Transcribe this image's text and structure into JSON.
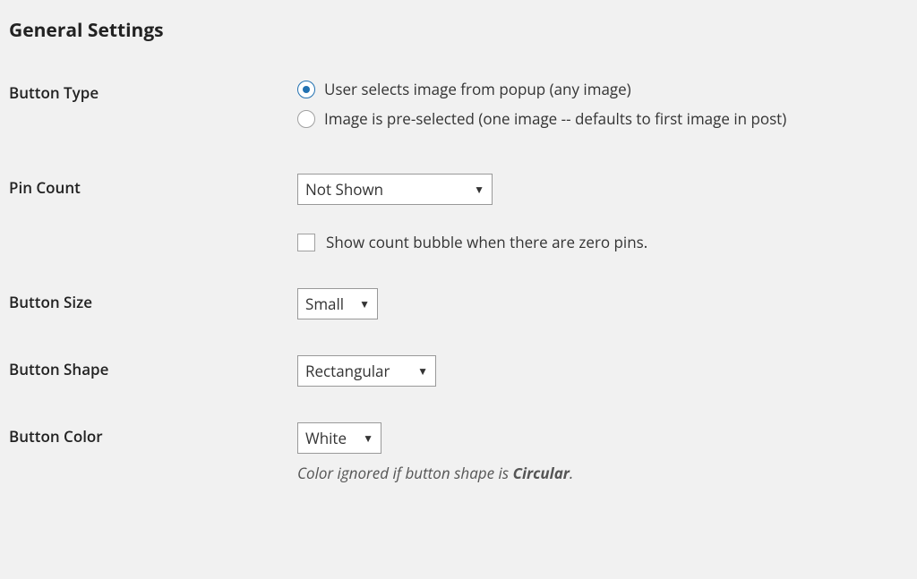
{
  "heading": "General Settings",
  "buttonType": {
    "label": "Button Type",
    "option1": "User selects image from popup (any image)",
    "option2": "Image is pre-selected (one image -- defaults to first image in post)"
  },
  "pinCount": {
    "label": "Pin Count",
    "selected": "Not Shown",
    "checkboxLabel": "Show count bubble when there are zero pins."
  },
  "buttonSize": {
    "label": "Button Size",
    "selected": "Small"
  },
  "buttonShape": {
    "label": "Button Shape",
    "selected": "Rectangular"
  },
  "buttonColor": {
    "label": "Button Color",
    "selected": "White",
    "descriptionPrefix": "Color ignored if button shape is ",
    "descriptionEm": "Circular",
    "descriptionSuffix": "."
  }
}
